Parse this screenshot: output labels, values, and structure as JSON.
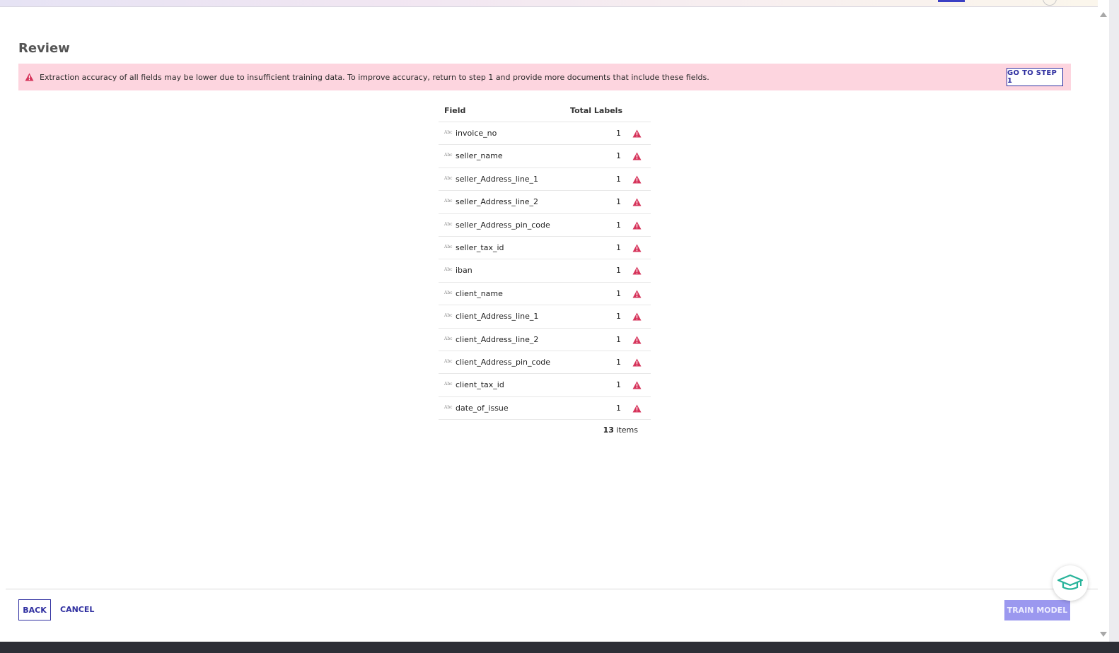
{
  "page": {
    "title": "Review"
  },
  "banner": {
    "message": "Extraction accuracy of all fields may be lower due to insufficient training data. To improve accuracy, return to step 1 and provide more documents that include these fields.",
    "icon": "warning-triangle-icon",
    "button_label": "GO TO STEP 1"
  },
  "table": {
    "columns": {
      "field": "Field",
      "total": "Total Labels"
    },
    "type_icon_label": "Abc",
    "rows": [
      {
        "field": "invoice_no",
        "total": "1"
      },
      {
        "field": "seller_name",
        "total": "1"
      },
      {
        "field": "seller_Address_line_1",
        "total": "1"
      },
      {
        "field": "seller_Address_line_2",
        "total": "1"
      },
      {
        "field": "seller_Address_pin_code",
        "total": "1"
      },
      {
        "field": "seller_tax_id",
        "total": "1"
      },
      {
        "field": "iban",
        "total": "1"
      },
      {
        "field": "client_name",
        "total": "1"
      },
      {
        "field": "client_Address_line_1",
        "total": "1"
      },
      {
        "field": "client_Address_line_2",
        "total": "1"
      },
      {
        "field": "client_Address_pin_code",
        "total": "1"
      },
      {
        "field": "client_tax_id",
        "total": "1"
      },
      {
        "field": "date_of_issue",
        "total": "1"
      }
    ],
    "footer": {
      "count": "13",
      "suffix": " items"
    }
  },
  "actions": {
    "back": "BACK",
    "cancel": "CANCEL",
    "train": "TRAIN MODEL"
  },
  "colors": {
    "accent": "#2f2fa0",
    "warning": "#d6335a",
    "banner_bg": "#fdd5df",
    "train_disabled": "#9b98ef",
    "help_icon": "#27b39a"
  }
}
